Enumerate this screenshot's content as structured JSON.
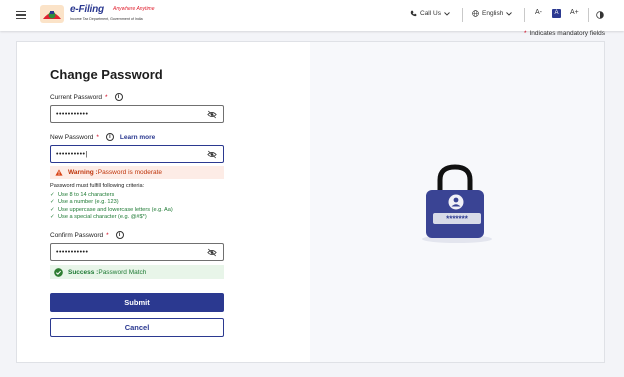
{
  "header": {
    "brand": "e-Filing",
    "tagline": "Anywhere Anytime",
    "department": "Income Tax Department, Government of India",
    "call_us": "Call Us",
    "language": "English",
    "font_small": "A-",
    "font_normal": "A",
    "font_large": "A+"
  },
  "mandatory_note": "Indicates mandatory fields",
  "page": {
    "title": "Change Password"
  },
  "form": {
    "current_password": {
      "label": "Current Password",
      "required_mark": "*",
      "value": "•••••••••••"
    },
    "new_password": {
      "label": "New Password",
      "required_mark": "*",
      "learn_more": "Learn more",
      "value": "••••••••••|"
    },
    "warning": {
      "prefix": "Warning :",
      "text": " Password is moderate"
    },
    "criteria_heading": "Password must fulfill following criteria:",
    "criteria": [
      "Use 8 to 14 characters",
      "Use a number (e.g. 123)",
      "Use uppercase and lowercase letters (e.g. Aa)",
      "Use a special character (e.g. @#$*)"
    ],
    "confirm_password": {
      "label": "Confirm Password",
      "required_mark": "*",
      "value": "•••••••••••"
    },
    "success": {
      "prefix": "Success :",
      "text": " Password Match"
    },
    "submit": "Submit",
    "cancel": "Cancel"
  },
  "illustration": {
    "mask": "*******"
  },
  "colors": {
    "primary": "#2b3990",
    "warning": "#bf360c",
    "success": "#1e7a34",
    "required": "#d0021b"
  }
}
